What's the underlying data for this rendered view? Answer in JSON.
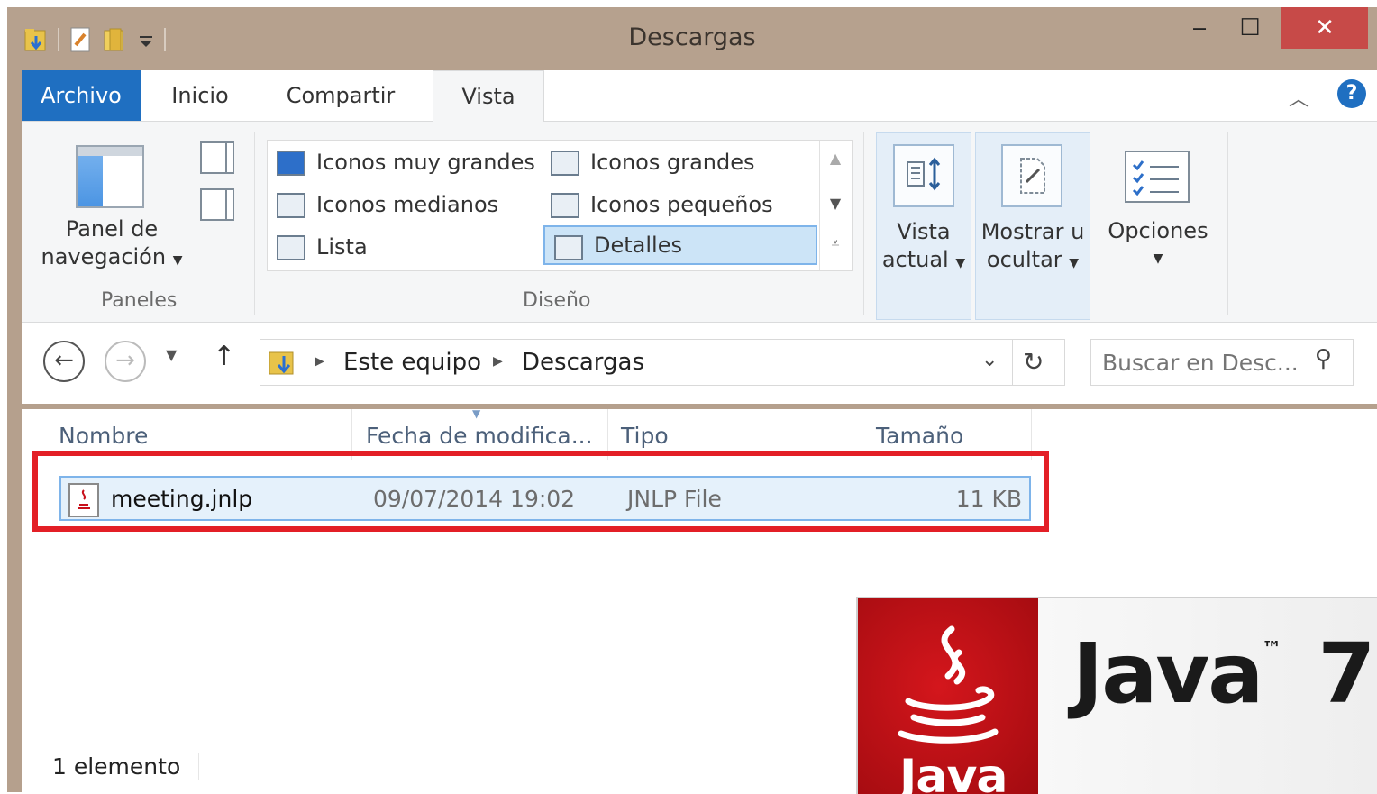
{
  "window": {
    "title": "Descargas"
  },
  "window_controls": {
    "minimize": "‒",
    "maximize": "☐",
    "close": "✕"
  },
  "ribbon_tabs": [
    {
      "label": "Archivo"
    },
    {
      "label": "Inicio"
    },
    {
      "label": "Compartir"
    },
    {
      "label": "Vista"
    }
  ],
  "panes": {
    "nav_pane_label_1": "Panel de",
    "nav_pane_label_2": "navegación",
    "group_label": "Paneles"
  },
  "layout": {
    "items": [
      {
        "label": "Iconos muy grandes"
      },
      {
        "label": "Iconos grandes"
      },
      {
        "label": "Iconos medianos"
      },
      {
        "label": "Iconos pequeños"
      },
      {
        "label": "Lista"
      },
      {
        "label": "Detalles"
      }
    ],
    "selected": "Detalles",
    "group_label": "Diseño"
  },
  "current_view": {
    "label_1": "Vista",
    "label_2": "actual"
  },
  "show_hide": {
    "label_1": "Mostrar u",
    "label_2": "ocultar"
  },
  "options": {
    "label": "Opciones"
  },
  "address": {
    "crumbs": [
      "Este equipo",
      "Descargas"
    ],
    "search_placeholder": "Buscar en Desc..."
  },
  "columns": [
    {
      "label": "Nombre"
    },
    {
      "label": "Fecha de modifica..."
    },
    {
      "label": "Tipo"
    },
    {
      "label": "Tamaño"
    }
  ],
  "files": [
    {
      "name": "meeting.jnlp",
      "modified": "09/07/2014 19:02",
      "type": "JNLP File",
      "size": "11 KB"
    }
  ],
  "status": {
    "count": "1 elemento"
  },
  "java_banner": {
    "title": "Java",
    "tm": "™",
    "version": "7",
    "logo_text": "Java",
    "accent": "#c8101b"
  },
  "colors": {
    "titlebar": "#b6a18e",
    "archivo_tab": "#1f6fc1",
    "close_button": "#c74a48",
    "highlight": "#e31f26",
    "selection": "#cce4f7"
  }
}
